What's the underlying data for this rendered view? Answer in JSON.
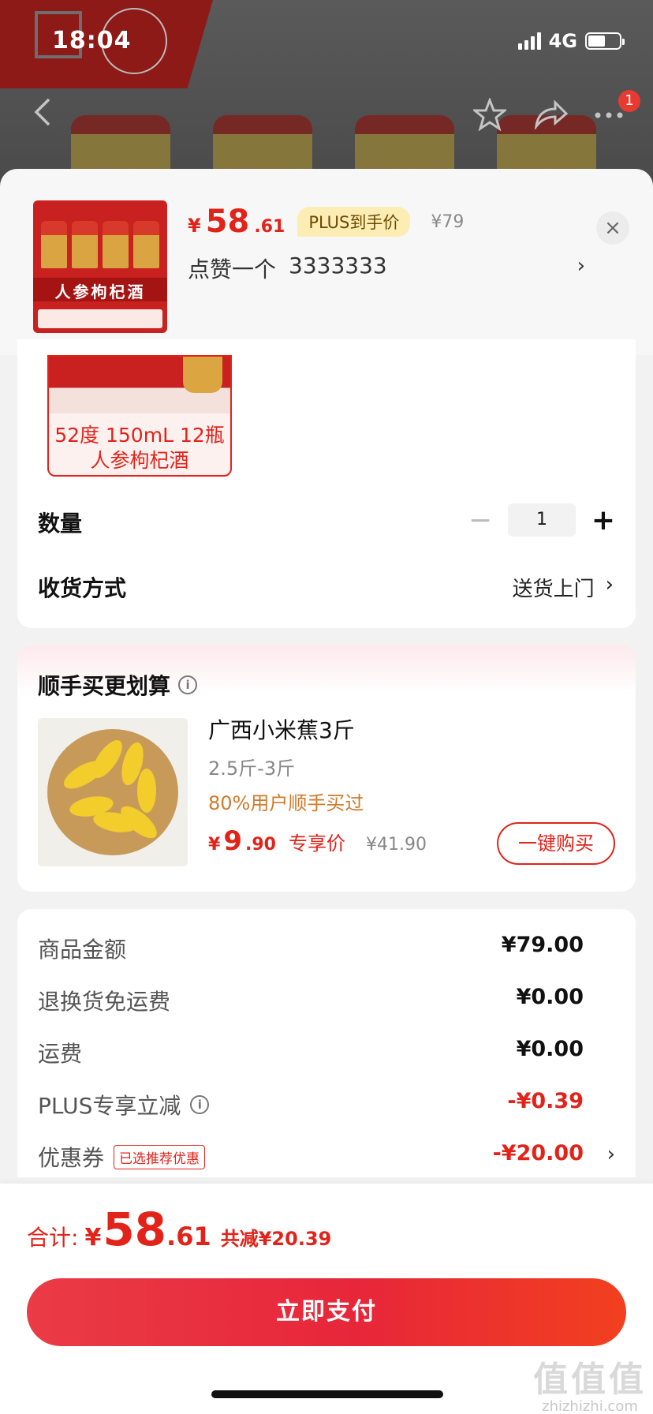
{
  "status_bar": {
    "time": "18:04",
    "network": "4G"
  },
  "header": {
    "badge_count": "1",
    "icons": [
      "back-icon",
      "star-icon",
      "share-icon",
      "more-icon"
    ],
    "jar_count": 4
  },
  "product": {
    "currency": "¥",
    "price_int": "58",
    "price_dec": ".61",
    "plus_tag": "PLUS到手价",
    "original_price": "¥79",
    "like_text": "点赞一个",
    "like_value": "3333333",
    "like_arrow": "›",
    "thumb_text": "人参枸杞酒",
    "close_symbol": "×"
  },
  "variant": {
    "label": "52度 150mL 12瓶 人参枸杞酒"
  },
  "quantity": {
    "label": "数量",
    "minus": "−",
    "value": "1",
    "plus": "+"
  },
  "delivery": {
    "label": "收货方式",
    "value": "送货上门",
    "arrow": "›"
  },
  "recommendation": {
    "title": "顺手买更划算",
    "info_symbol": "i",
    "name": "广西小米蕉3斤",
    "spec": "2.5斤-3斤",
    "note": "80%用户顺手买过",
    "currency": "¥",
    "price_int": "9",
    "price_dec": ".90",
    "price_tag": "专享价",
    "original_price": "¥41.90",
    "buy_label": "一键购买"
  },
  "fees": {
    "rows": [
      {
        "label": "商品金额",
        "value": "¥79.00"
      },
      {
        "label": "退换货免运费",
        "value": "¥0.00"
      },
      {
        "label": "运费",
        "value": "¥0.00"
      },
      {
        "label": "PLUS专享立减",
        "value": "-¥0.39"
      },
      {
        "label": "优惠券",
        "tag": "已选推荐优惠",
        "value": "-¥20.00",
        "arrow": "›"
      }
    ]
  },
  "footer": {
    "total_label": "合计:",
    "currency": "¥",
    "total_int": "58",
    "total_dec": ".61",
    "saved": "共减¥20.39",
    "pay_label": "立即支付"
  },
  "watermark": {
    "big": "值值值",
    "small": "zhizhizhi.com"
  },
  "colors": {
    "accent": "#e2231a",
    "plus_tag_bg": "#fcedb5",
    "note_orange": "#d07a2a",
    "pay_gradient_start": "#ea3b46",
    "pay_gradient_end": "#f2401f"
  }
}
